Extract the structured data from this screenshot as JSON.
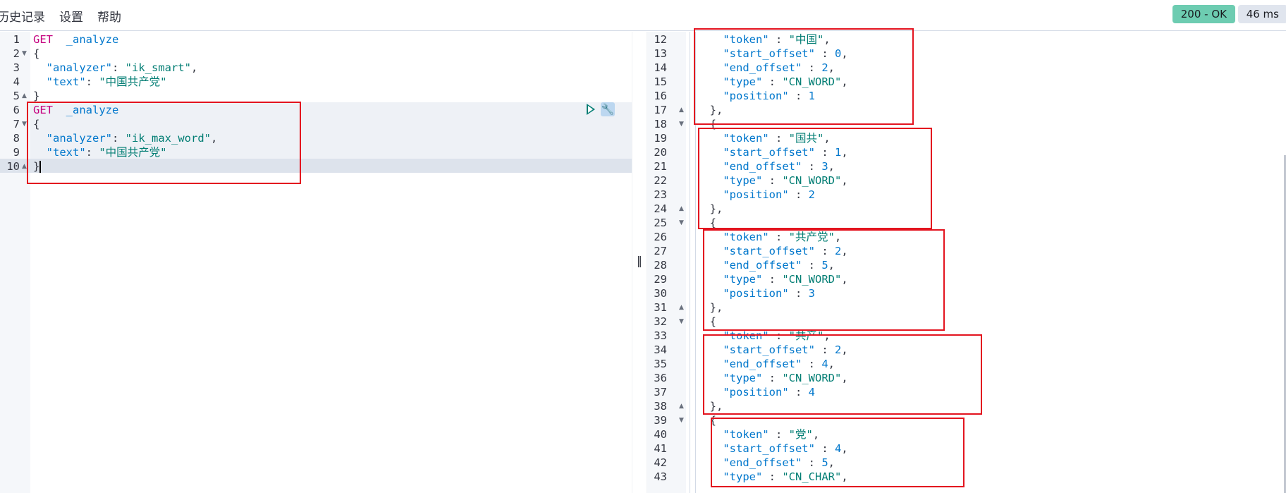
{
  "menu": [
    "历史记录",
    "设置",
    "帮助"
  ],
  "status": {
    "code": "200 - OK",
    "time": "46 ms"
  },
  "request": [
    {
      "n": "1",
      "fold": "",
      "tokens": [
        [
          "kw",
          "GET"
        ],
        [
          "punct",
          "  "
        ],
        [
          "url",
          "_analyze"
        ]
      ]
    },
    {
      "n": "2",
      "fold": "▼",
      "tokens": [
        [
          "punct",
          "{"
        ]
      ]
    },
    {
      "n": "3",
      "fold": "",
      "tokens": [
        [
          "punct",
          "  "
        ],
        [
          "key",
          "\"analyzer\""
        ],
        [
          "punct",
          ": "
        ],
        [
          "str",
          "\"ik_smart\""
        ],
        [
          "punct",
          ","
        ]
      ]
    },
    {
      "n": "4",
      "fold": "",
      "tokens": [
        [
          "punct",
          "  "
        ],
        [
          "key",
          "\"text\""
        ],
        [
          "punct",
          ": "
        ],
        [
          "str",
          "\"中国共产党\""
        ]
      ]
    },
    {
      "n": "5",
      "fold": "▲",
      "tokens": [
        [
          "punct",
          "}"
        ]
      ]
    },
    {
      "n": "6",
      "fold": "",
      "tokens": [
        [
          "kw",
          "GET"
        ],
        [
          "punct",
          "  "
        ],
        [
          "url",
          "_analyze"
        ]
      ]
    },
    {
      "n": "7",
      "fold": "▼",
      "tokens": [
        [
          "punct",
          "{"
        ]
      ]
    },
    {
      "n": "8",
      "fold": "",
      "tokens": [
        [
          "punct",
          "  "
        ],
        [
          "key",
          "\"analyzer\""
        ],
        [
          "punct",
          ": "
        ],
        [
          "str",
          "\"ik_max_word\""
        ],
        [
          "punct",
          ","
        ]
      ]
    },
    {
      "n": "9",
      "fold": "",
      "tokens": [
        [
          "punct",
          "  "
        ],
        [
          "key",
          "\"text\""
        ],
        [
          "punct",
          ": "
        ],
        [
          "str",
          "\"中国共产党\""
        ]
      ]
    },
    {
      "n": "10",
      "fold": "▲",
      "tokens": [
        [
          "punct",
          "}"
        ],
        [
          "cursor",
          ""
        ]
      ]
    }
  ],
  "response": [
    {
      "n": "12",
      "fold": "",
      "tokens": [
        [
          "punct",
          "    "
        ],
        [
          "key",
          "\"token\""
        ],
        [
          "punct",
          " : "
        ],
        [
          "str",
          "\"中国\""
        ],
        [
          "punct",
          ","
        ]
      ]
    },
    {
      "n": "13",
      "fold": "",
      "tokens": [
        [
          "punct",
          "    "
        ],
        [
          "key",
          "\"start_offset\""
        ],
        [
          "punct",
          " : "
        ],
        [
          "num",
          "0"
        ],
        [
          "punct",
          ","
        ]
      ]
    },
    {
      "n": "14",
      "fold": "",
      "tokens": [
        [
          "punct",
          "    "
        ],
        [
          "key",
          "\"end_offset\""
        ],
        [
          "punct",
          " : "
        ],
        [
          "num",
          "2"
        ],
        [
          "punct",
          ","
        ]
      ]
    },
    {
      "n": "15",
      "fold": "",
      "tokens": [
        [
          "punct",
          "    "
        ],
        [
          "key",
          "\"type\""
        ],
        [
          "punct",
          " : "
        ],
        [
          "str",
          "\"CN_WORD\""
        ],
        [
          "punct",
          ","
        ]
      ]
    },
    {
      "n": "16",
      "fold": "",
      "tokens": [
        [
          "punct",
          "    "
        ],
        [
          "key",
          "\"position\""
        ],
        [
          "punct",
          " : "
        ],
        [
          "num",
          "1"
        ]
      ]
    },
    {
      "n": "17",
      "fold": "▲",
      "tokens": [
        [
          "punct",
          "  },"
        ]
      ]
    },
    {
      "n": "18",
      "fold": "▼",
      "tokens": [
        [
          "punct",
          "  {"
        ]
      ]
    },
    {
      "n": "19",
      "fold": "",
      "tokens": [
        [
          "punct",
          "    "
        ],
        [
          "key",
          "\"token\""
        ],
        [
          "punct",
          " : "
        ],
        [
          "str",
          "\"国共\""
        ],
        [
          "punct",
          ","
        ]
      ]
    },
    {
      "n": "20",
      "fold": "",
      "tokens": [
        [
          "punct",
          "    "
        ],
        [
          "key",
          "\"start_offset\""
        ],
        [
          "punct",
          " : "
        ],
        [
          "num",
          "1"
        ],
        [
          "punct",
          ","
        ]
      ]
    },
    {
      "n": "21",
      "fold": "",
      "tokens": [
        [
          "punct",
          "    "
        ],
        [
          "key",
          "\"end_offset\""
        ],
        [
          "punct",
          " : "
        ],
        [
          "num",
          "3"
        ],
        [
          "punct",
          ","
        ]
      ]
    },
    {
      "n": "22",
      "fold": "",
      "tokens": [
        [
          "punct",
          "    "
        ],
        [
          "key",
          "\"type\""
        ],
        [
          "punct",
          " : "
        ],
        [
          "str",
          "\"CN_WORD\""
        ],
        [
          "punct",
          ","
        ]
      ]
    },
    {
      "n": "23",
      "fold": "",
      "tokens": [
        [
          "punct",
          "    "
        ],
        [
          "key",
          "\"position\""
        ],
        [
          "punct",
          " : "
        ],
        [
          "num",
          "2"
        ]
      ]
    },
    {
      "n": "24",
      "fold": "▲",
      "tokens": [
        [
          "punct",
          "  },"
        ]
      ]
    },
    {
      "n": "25",
      "fold": "▼",
      "tokens": [
        [
          "punct",
          "  {"
        ]
      ]
    },
    {
      "n": "26",
      "fold": "",
      "tokens": [
        [
          "punct",
          "    "
        ],
        [
          "key",
          "\"token\""
        ],
        [
          "punct",
          " : "
        ],
        [
          "str",
          "\"共产党\""
        ],
        [
          "punct",
          ","
        ]
      ]
    },
    {
      "n": "27",
      "fold": "",
      "tokens": [
        [
          "punct",
          "    "
        ],
        [
          "key",
          "\"start_offset\""
        ],
        [
          "punct",
          " : "
        ],
        [
          "num",
          "2"
        ],
        [
          "punct",
          ","
        ]
      ]
    },
    {
      "n": "28",
      "fold": "",
      "tokens": [
        [
          "punct",
          "    "
        ],
        [
          "key",
          "\"end_offset\""
        ],
        [
          "punct",
          " : "
        ],
        [
          "num",
          "5"
        ],
        [
          "punct",
          ","
        ]
      ]
    },
    {
      "n": "29",
      "fold": "",
      "tokens": [
        [
          "punct",
          "    "
        ],
        [
          "key",
          "\"type\""
        ],
        [
          "punct",
          " : "
        ],
        [
          "str",
          "\"CN_WORD\""
        ],
        [
          "punct",
          ","
        ]
      ]
    },
    {
      "n": "30",
      "fold": "",
      "tokens": [
        [
          "punct",
          "    "
        ],
        [
          "key",
          "\"position\""
        ],
        [
          "punct",
          " : "
        ],
        [
          "num",
          "3"
        ]
      ]
    },
    {
      "n": "31",
      "fold": "▲",
      "tokens": [
        [
          "punct",
          "  },"
        ]
      ]
    },
    {
      "n": "32",
      "fold": "▼",
      "tokens": [
        [
          "punct",
          "  {"
        ]
      ]
    },
    {
      "n": "33",
      "fold": "",
      "tokens": [
        [
          "punct",
          "    "
        ],
        [
          "key",
          "\"token\""
        ],
        [
          "punct",
          " : "
        ],
        [
          "str",
          "\"共产\""
        ],
        [
          "punct",
          ","
        ]
      ]
    },
    {
      "n": "34",
      "fold": "",
      "tokens": [
        [
          "punct",
          "    "
        ],
        [
          "key",
          "\"start_offset\""
        ],
        [
          "punct",
          " : "
        ],
        [
          "num",
          "2"
        ],
        [
          "punct",
          ","
        ]
      ]
    },
    {
      "n": "35",
      "fold": "",
      "tokens": [
        [
          "punct",
          "    "
        ],
        [
          "key",
          "\"end_offset\""
        ],
        [
          "punct",
          " : "
        ],
        [
          "num",
          "4"
        ],
        [
          "punct",
          ","
        ]
      ]
    },
    {
      "n": "36",
      "fold": "",
      "tokens": [
        [
          "punct",
          "    "
        ],
        [
          "key",
          "\"type\""
        ],
        [
          "punct",
          " : "
        ],
        [
          "str",
          "\"CN_WORD\""
        ],
        [
          "punct",
          ","
        ]
      ]
    },
    {
      "n": "37",
      "fold": "",
      "tokens": [
        [
          "punct",
          "    "
        ],
        [
          "key",
          "\"position\""
        ],
        [
          "punct",
          " : "
        ],
        [
          "num",
          "4"
        ]
      ]
    },
    {
      "n": "38",
      "fold": "▲",
      "tokens": [
        [
          "punct",
          "  },"
        ]
      ]
    },
    {
      "n": "39",
      "fold": "▼",
      "tokens": [
        [
          "punct",
          "  {"
        ]
      ]
    },
    {
      "n": "40",
      "fold": "",
      "tokens": [
        [
          "punct",
          "    "
        ],
        [
          "key",
          "\"token\""
        ],
        [
          "punct",
          " : "
        ],
        [
          "str",
          "\"党\""
        ],
        [
          "punct",
          ","
        ]
      ]
    },
    {
      "n": "41",
      "fold": "",
      "tokens": [
        [
          "punct",
          "    "
        ],
        [
          "key",
          "\"start_offset\""
        ],
        [
          "punct",
          " : "
        ],
        [
          "num",
          "4"
        ],
        [
          "punct",
          ","
        ]
      ]
    },
    {
      "n": "42",
      "fold": "",
      "tokens": [
        [
          "punct",
          "    "
        ],
        [
          "key",
          "\"end_offset\""
        ],
        [
          "punct",
          " : "
        ],
        [
          "num",
          "5"
        ],
        [
          "punct",
          ","
        ]
      ]
    },
    {
      "n": "43",
      "fold": "",
      "tokens": [
        [
          "punct",
          "    "
        ],
        [
          "key",
          "\"type\""
        ],
        [
          "punct",
          " : "
        ],
        [
          "str",
          "\"CN_CHAR\""
        ],
        [
          "punct",
          ","
        ]
      ]
    }
  ]
}
